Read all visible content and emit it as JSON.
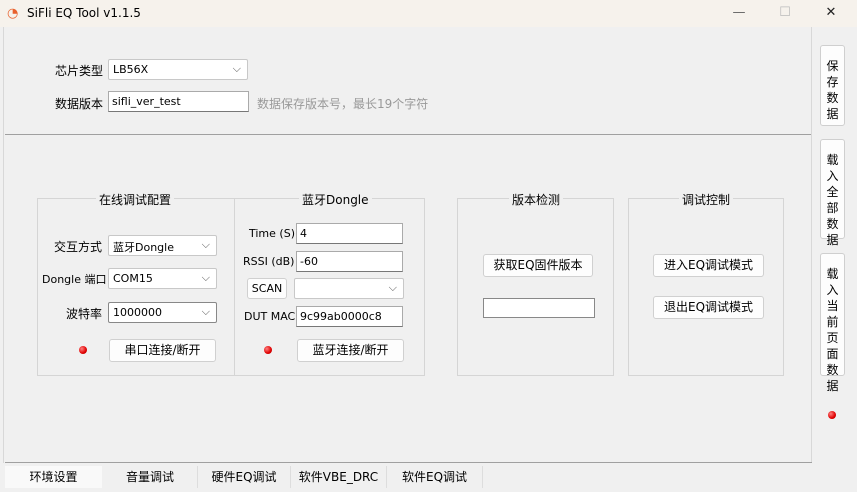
{
  "window": {
    "title": "SiFli EQ Tool v1.1.5",
    "minimize": "—",
    "maximize": "☐",
    "close": "✕"
  },
  "top": {
    "chip_label": "芯片类型",
    "chip_value": "LB56X",
    "version_label": "数据版本",
    "version_value": "sifli_ver_test",
    "version_hint": "数据保存版本号，最长19个字符"
  },
  "online": {
    "title": "在线调试配置",
    "mode_label": "交互方式",
    "mode_value": "蓝牙Dongle",
    "port_label": "Dongle 端口",
    "port_value": "COM15",
    "baud_label": "波特率",
    "baud_value": "1000000",
    "connect": "串口连接/断开",
    "status_color": "#e00000"
  },
  "dongle": {
    "title": "蓝牙Dongle",
    "time_label": "Time (S)",
    "time_value": "4",
    "rssi_label": "RSSI (dB)",
    "rssi_value": "-60",
    "scan": "SCAN",
    "scan_value": "",
    "mac_label": "DUT MAC",
    "mac_value": "9c99ab0000c8",
    "connect": "蓝牙连接/断开"
  },
  "version": {
    "title": "版本检测",
    "get": "获取EQ固件版本",
    "value": ""
  },
  "debug": {
    "title": "调试控制",
    "enter": "进入EQ调试模式",
    "exit": "退出EQ调试模式"
  },
  "side": {
    "save": "保存数据",
    "load_all": "载入全部数据",
    "load_page": "载入当前页面数据"
  },
  "tabs": [
    {
      "label": "环境设置",
      "active": true
    },
    {
      "label": "音量调试"
    },
    {
      "label": "硬件EQ调试"
    },
    {
      "label": "软件VBE_DRC"
    },
    {
      "label": "软件EQ调试"
    }
  ]
}
